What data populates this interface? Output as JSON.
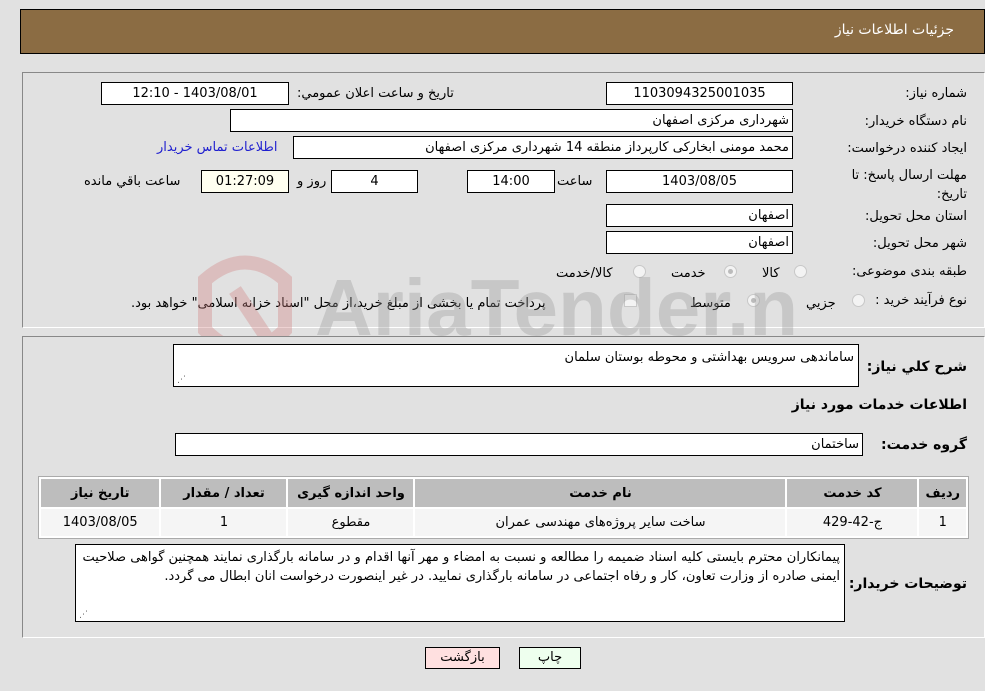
{
  "header": {
    "title": "جزئیات اطلاعات نیاز"
  },
  "details": {
    "need_number_label": "شماره نیاز:",
    "need_number": "1103094325001035",
    "announce_label": "تاریخ و ساعت اعلان عمومي:",
    "announce_value": "1403/08/01 - 12:10",
    "buyer_org_label": "نام دستگاه خریدار:",
    "buyer_org": "شهرداری مرکزی اصفهان",
    "creator_label": "ایجاد کننده درخواست:",
    "creator": "محمد مومنی ابخارکی کارپرداز منطقه 14 شهرداری مرکزی اصفهان",
    "contact_link": "اطلاعات تماس خریدار",
    "deadline_label": "مهلت ارسال پاسخ: تا تاریخ:",
    "deadline_date": "1403/08/05",
    "time_label": "ساعت",
    "deadline_time": "14:00",
    "days_value": "4",
    "days_label": "روز و",
    "remaining_time": "01:27:09",
    "remaining_label": "ساعت باقي مانده",
    "province_label": "استان محل تحویل:",
    "province": "اصفهان",
    "city_label": "شهر محل تحویل:",
    "city": "اصفهان",
    "category_label": "طبقه بندی موضوعی:",
    "category_options": [
      {
        "label": "کالا",
        "checked": false
      },
      {
        "label": "خدمت",
        "checked": true
      },
      {
        "label": "کالا/خدمت",
        "checked": false
      }
    ],
    "process_label": "نوع فرآیند خرید :",
    "process_options": [
      {
        "label": "جزيي",
        "checked": false
      },
      {
        "label": "متوسط",
        "checked": true
      }
    ],
    "treasury_note": "پرداخت تمام یا بخشی از مبلغ خرید،از محل \"اسناد خزانه اسلامی\" خواهد بود."
  },
  "summary": {
    "general_desc_label": "شرح کلي نیاز:",
    "general_desc": "ساماندهی سرویس بهداشتی و محوطه بوستان سلمان",
    "services_title": "اطلاعات خدمات مورد نیاز",
    "service_group_label": "گروه خدمت:",
    "service_group": "ساختمان"
  },
  "table": {
    "headers": [
      "ردیف",
      "کد خدمت",
      "نام خدمت",
      "واحد اندازه گیری",
      "تعداد / مقدار",
      "تاریخ نیاز"
    ],
    "rows": [
      [
        "1",
        "ج-42-429",
        "ساخت سایر پروژه‌های مهندسی عمران",
        "مقطوع",
        "1",
        "1403/08/05"
      ]
    ]
  },
  "buyer_notes": {
    "label": "توضیحات خریدار:",
    "text": "پیمانکاران محترم بایستی کلیه اسناد ضمیمه را مطالعه و نسبت به امضاء و مهر آنها اقدام و در سامانه بارگذاری نمایند همچنین گواهی صلاحیت ایمنی صادره از وزارت تعاون، کار و رفاه اجتماعی در سامانه بارگذاری نمایید. در غیر اینصورت درخواست انان ابطال می گردد."
  },
  "buttons": {
    "print": "چاپ",
    "back": "بازگشت"
  },
  "watermark": {
    "text": "AriaTender.neT"
  },
  "colors": {
    "header": "#8b6c43",
    "link": "#1f1fcf",
    "print_bg": "#eeffee",
    "back_bg": "#ffe0e0",
    "remaining_bg": "#fffff0"
  }
}
